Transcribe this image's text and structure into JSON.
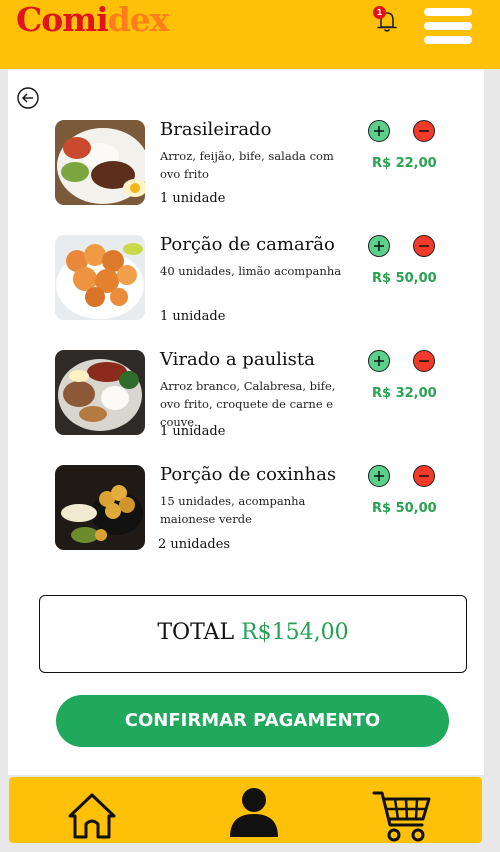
{
  "app": {
    "logo_part1": "Comi",
    "logo_part2": "dex",
    "notification_count": "1"
  },
  "cart": {
    "items": [
      {
        "name": "Brasileirado",
        "description": "Arroz, feijão, bife, salada com ovo frito",
        "quantity": "1 unidade",
        "price": "R$ 22,00"
      },
      {
        "name": "Porção de camarão",
        "description": "40 unidades, limão acompanha",
        "quantity": "1 unidade",
        "price": "R$ 50,00"
      },
      {
        "name": "Virado a paulista",
        "description": "Arroz branco, Calabresa, bife, ovo frito, croquete de carne e couve.",
        "quantity": "1 unidade",
        "price": "R$ 32,00"
      },
      {
        "name": "Porção de coxinhas",
        "description": "15 unidades, acompanha maionese verde",
        "quantity": "2 unidades",
        "price": "R$ 50,00"
      }
    ]
  },
  "total": {
    "label": "TOTAL",
    "value": "R$154,00"
  },
  "actions": {
    "confirm_label": "CONFIRMAR PAGAMENTO"
  },
  "colors": {
    "brand_yellow": "#ffc107",
    "accent_green": "#20a85c",
    "remove_red": "#f23a2a",
    "logo_red": "#e0141b",
    "logo_orange": "#ff7d1a"
  },
  "icons": [
    "bell-icon",
    "hamburger-menu-icon",
    "back-arrow-icon",
    "plus-icon",
    "minus-icon",
    "home-icon",
    "user-icon",
    "cart-icon"
  ]
}
